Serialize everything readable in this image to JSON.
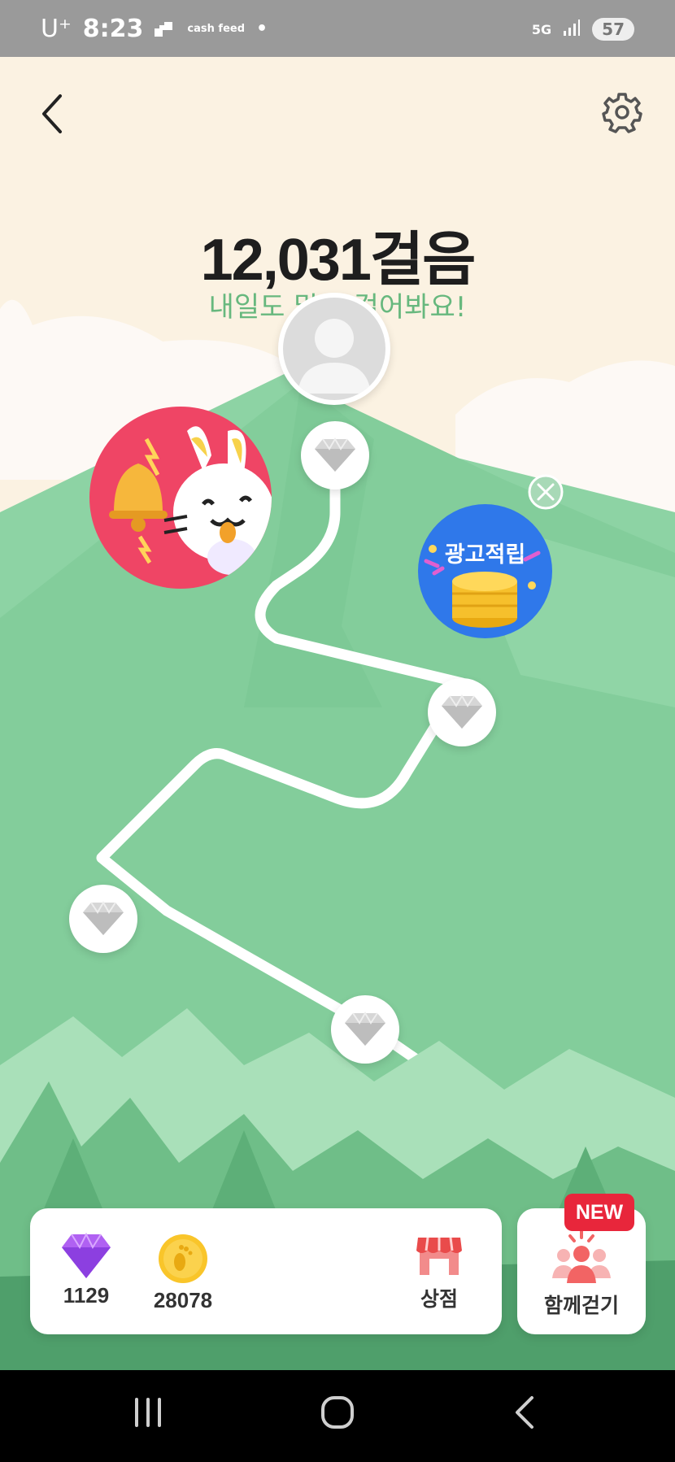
{
  "status_bar": {
    "carrier": "U⁺",
    "time": "8:23",
    "app_badge": "cash feed",
    "network": "5G",
    "battery": "57"
  },
  "header": {
    "back_icon": "chevron-left-icon",
    "settings_icon": "gear-icon"
  },
  "steps": {
    "count_text": "12,031걸음",
    "subtitle": "내일도 많이 걸어봐요!"
  },
  "map": {
    "milestone_icon": "diamond-icon",
    "ad_bubble_label": "광고적립"
  },
  "bottom": {
    "gems": "1129",
    "coins": "28078",
    "shop_label": "상점",
    "walk_together_label": "함께걷기",
    "new_badge": "NEW"
  },
  "colors": {
    "mountain": "#83cd9b",
    "path": "#ffffff",
    "subtitle": "#67b87e",
    "badge": "#e8263b"
  }
}
